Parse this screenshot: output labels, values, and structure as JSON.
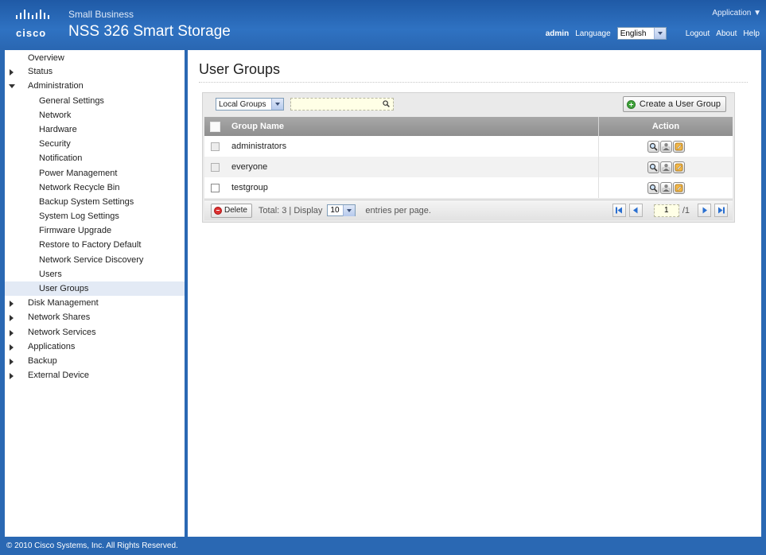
{
  "header": {
    "logo_text": "cisco",
    "brand_small": "Small Business",
    "product": "NSS 326 Smart Storage",
    "app_menu": "Application ▼",
    "user": "admin",
    "language_label": "Language",
    "language_value": "English",
    "logout": "Logout",
    "about": "About",
    "help": "Help"
  },
  "sidebar": {
    "items": [
      {
        "label": "Overview"
      },
      {
        "label": "Status"
      },
      {
        "label": "Administration"
      },
      {
        "label": "General Settings"
      },
      {
        "label": "Network"
      },
      {
        "label": "Hardware"
      },
      {
        "label": "Security"
      },
      {
        "label": "Notification"
      },
      {
        "label": "Power Management"
      },
      {
        "label": "Network Recycle Bin"
      },
      {
        "label": "Backup System Settings"
      },
      {
        "label": "System Log Settings"
      },
      {
        "label": "Firmware Upgrade"
      },
      {
        "label": "Restore to Factory Default"
      },
      {
        "label": "Network Service Discovery"
      },
      {
        "label": "Users"
      },
      {
        "label": "User Groups"
      },
      {
        "label": "Disk Management"
      },
      {
        "label": "Network Shares"
      },
      {
        "label": "Network Services"
      },
      {
        "label": "Applications"
      },
      {
        "label": "Backup"
      },
      {
        "label": "External Device"
      }
    ]
  },
  "main": {
    "title": "User Groups",
    "filter_value": "Local Groups",
    "search_value": "",
    "create_label": "Create a User Group",
    "columns": {
      "name": "Group Name",
      "action": "Action"
    },
    "rows": [
      {
        "name": "administrators"
      },
      {
        "name": "everyone"
      },
      {
        "name": "testgroup"
      }
    ],
    "pager": {
      "delete_label": "Delete",
      "total_text": "Total:  3  |   Display",
      "per_page": "10",
      "entries_text": "entries per page.",
      "page": "1",
      "page_total": "/1"
    }
  },
  "footer": {
    "copyright": "© 2010 Cisco Systems, Inc. All Rights Reserved."
  },
  "colors": {
    "brand_blue": "#2a68b3",
    "grid_header": "#999999",
    "add_green": "#3fa33a",
    "delete_red": "#dd3333"
  }
}
